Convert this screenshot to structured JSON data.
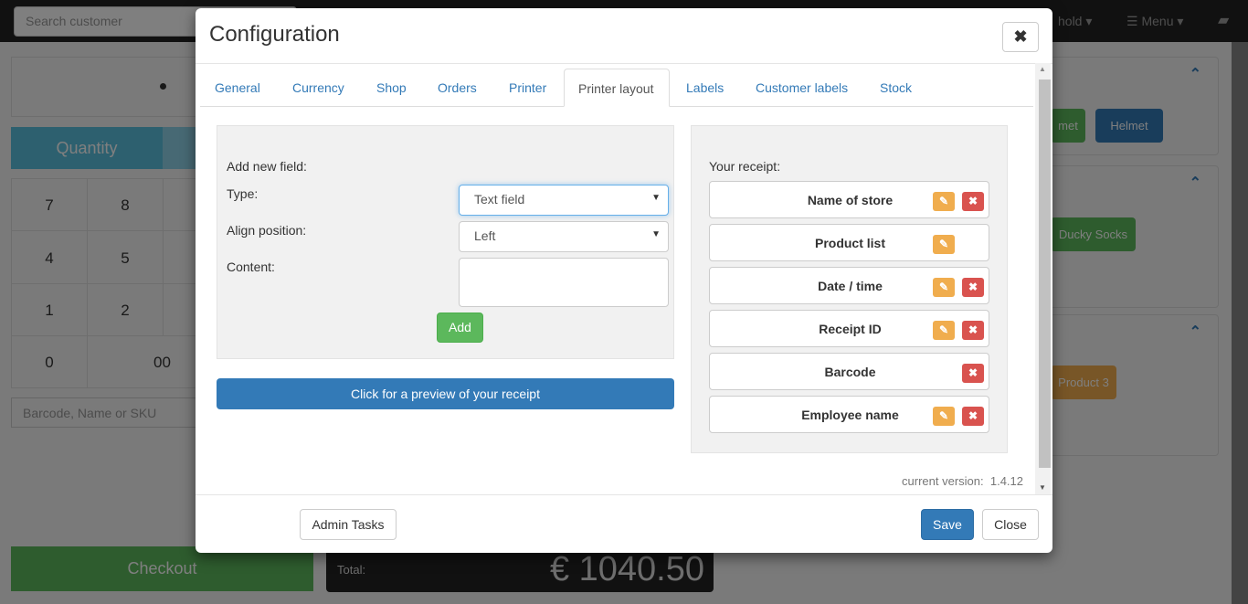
{
  "background": {
    "search_placeholder": "Search customer",
    "nav": {
      "hold_label": "hold",
      "menu_label": "Menu"
    },
    "quantity_label": "Quantity",
    "keypad": [
      "7",
      "8",
      "4",
      "5",
      "1",
      "2",
      "0",
      "00"
    ],
    "barcode_placeholder": "Barcode, Name or SKU",
    "checkout_label": "Checkout",
    "total_label": "Total:",
    "total_value": "€ 1040.50",
    "products": [
      "met",
      "Helmet",
      "Ducky Socks",
      "Product 3"
    ]
  },
  "modal": {
    "title": "Configuration",
    "tabs": [
      {
        "label": "General"
      },
      {
        "label": "Currency"
      },
      {
        "label": "Shop"
      },
      {
        "label": "Orders"
      },
      {
        "label": "Printer"
      },
      {
        "label": "Printer layout",
        "active": true
      },
      {
        "label": "Labels"
      },
      {
        "label": "Customer labels"
      },
      {
        "label": "Stock"
      }
    ],
    "form": {
      "heading": "Add new field:",
      "type_label": "Type:",
      "type_value": "Text field",
      "align_label": "Align position:",
      "align_value": "Left",
      "content_label": "Content:",
      "content_value": "",
      "add_label": "Add"
    },
    "preview_label": "Click for a preview of your receipt",
    "receipt": {
      "heading": "Your receipt:",
      "items": [
        {
          "label": "Name of store",
          "editable": true,
          "deletable": true
        },
        {
          "label": "Product list",
          "editable": true,
          "deletable": false
        },
        {
          "label": "Date / time",
          "editable": true,
          "deletable": true
        },
        {
          "label": "Receipt ID",
          "editable": true,
          "deletable": true
        },
        {
          "label": "Barcode",
          "editable": false,
          "deletable": true
        },
        {
          "label": "Employee name",
          "editable": true,
          "deletable": true
        }
      ]
    },
    "version": "current version:  1.4.12",
    "footer": {
      "admin_label": "Admin Tasks",
      "save_label": "Save",
      "close_label": "Close"
    },
    "colors": {
      "primary": "#337ab7",
      "success": "#5cb85c",
      "warning": "#f0ad4e",
      "danger": "#d9534f"
    }
  }
}
